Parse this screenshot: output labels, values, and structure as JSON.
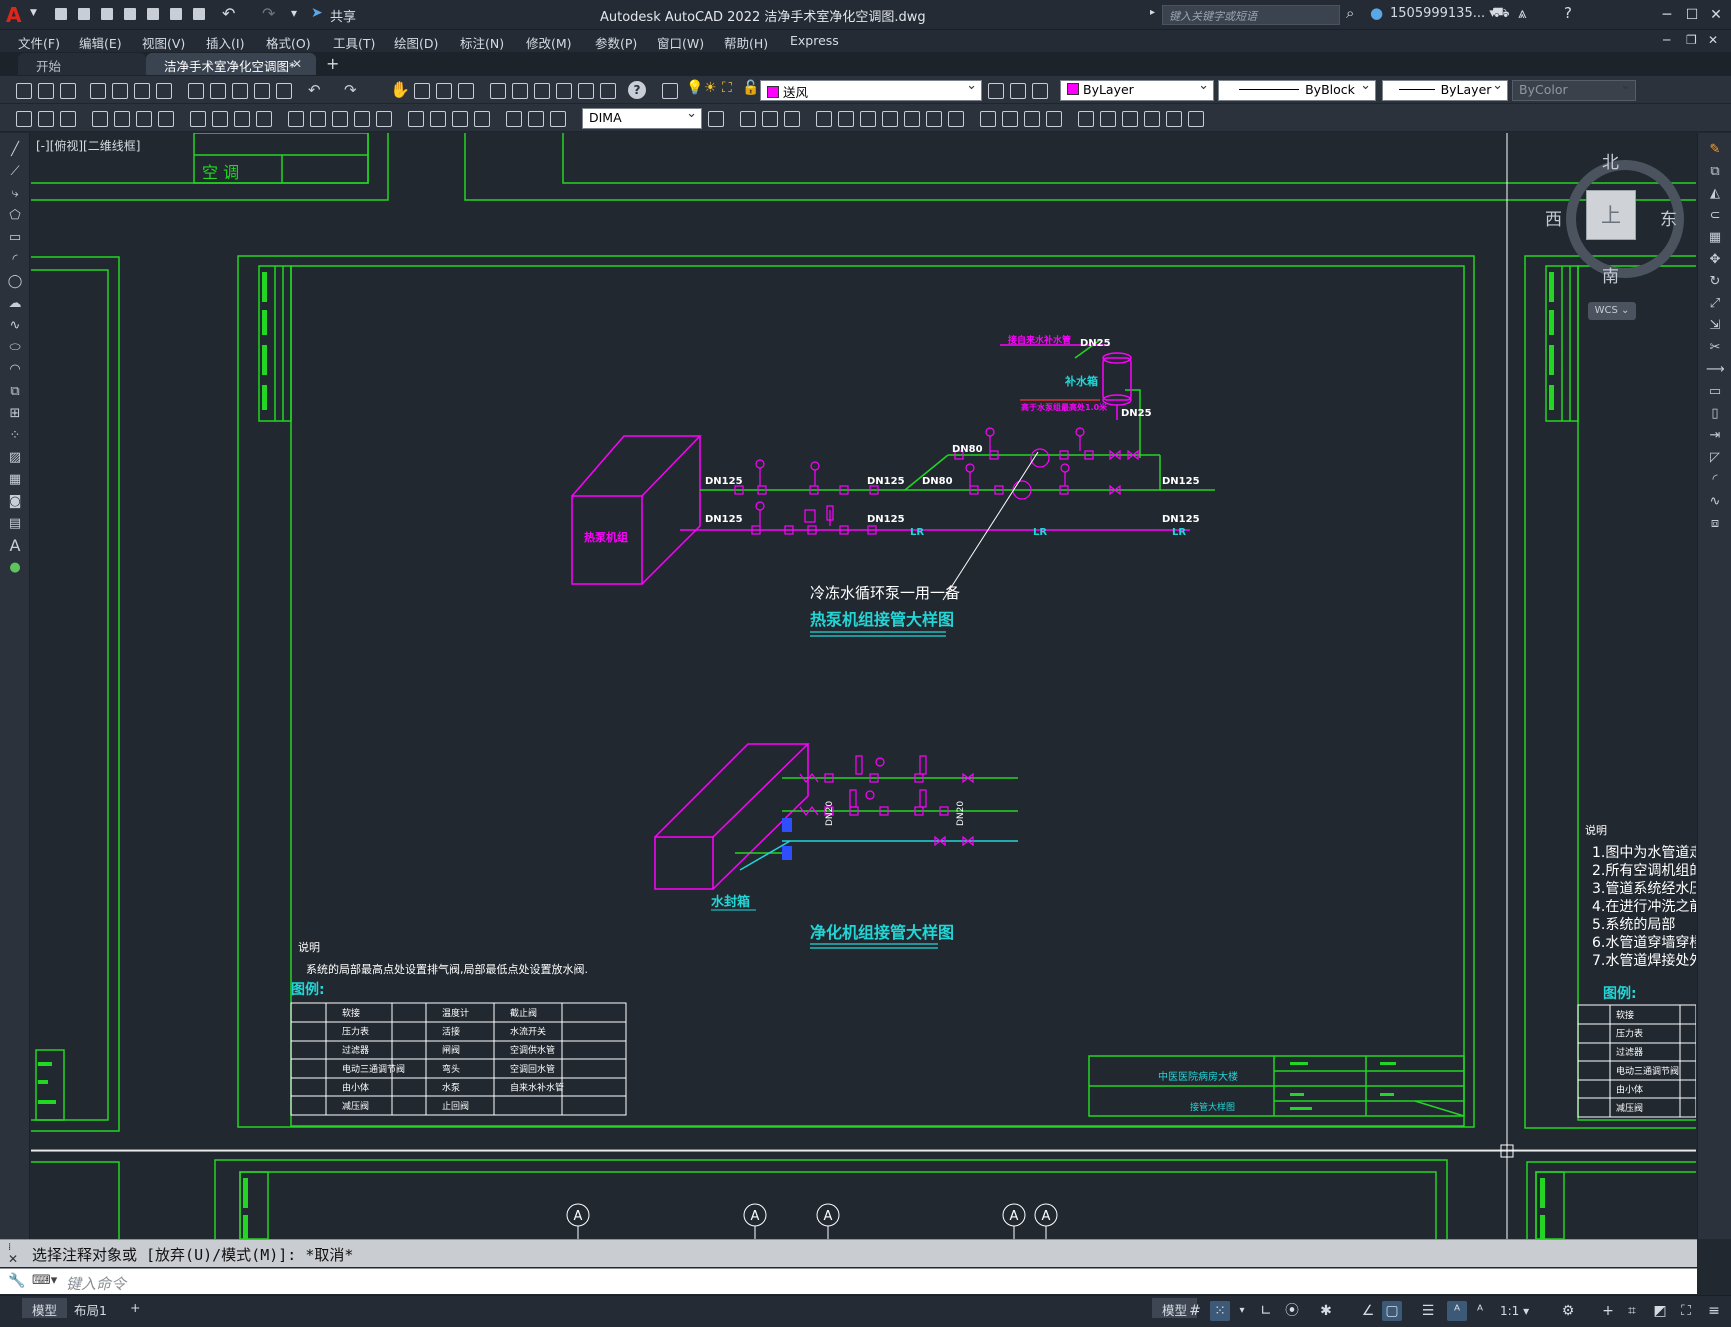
{
  "titlebar": {
    "app_title": "Autodesk AutoCAD 2022    洁净手术室净化空调图.dwg",
    "share_label": "共享",
    "search_placeholder": "键入关键字或短语",
    "user_name": "1505999135... ▾",
    "min": "─",
    "max": "☐",
    "close": "✕"
  },
  "menu": [
    "文件(F)",
    "编辑(E)",
    "视图(V)",
    "插入(I)",
    "格式(O)",
    "工具(T)",
    "绘图(D)",
    "标注(N)",
    "修改(M)",
    "参数(P)",
    "窗口(W)",
    "帮助(H)",
    "Express"
  ],
  "tabs": {
    "start": "开始",
    "active": "洁净手术室净化空调图*",
    "close": "✕",
    "add": "+"
  },
  "properties": {
    "layer": "送风",
    "color": "ByLayer",
    "linetype": "ByBlock",
    "lineweight": "ByLayer",
    "plotstyle": "ByColor",
    "dimstyle": "DIMA",
    "accent_color": "#ff00ff"
  },
  "viewport_label": "[-][俯视][二维线框]",
  "viewcube": {
    "north": "北",
    "south": "南",
    "east": "东",
    "west": "西",
    "top": "上",
    "wcs": "WCS ⌄"
  },
  "drawing": {
    "unit_label": "热泵机组",
    "tank_label": "补水箱",
    "tank_note": "接自来水补水管",
    "tank_note2": "高于水泵组最高处1.0米",
    "pump_note": "冷冻水循环泵一用一备",
    "title1": "热泵机组接管大样图",
    "title2": "净化机组接管大样图",
    "seal_label": "水封箱",
    "dn125": "DN125",
    "dn80": "DN80",
    "dn25": "DN25",
    "dn20": "DN20",
    "lr": "LR",
    "notes_head": "说明",
    "notes_text": "系统的局部最高点处设置排气阀,局部最低点处设置放水阀.",
    "legend_head": "图例:",
    "legend": [
      [
        "软接",
        "温度计",
        "截止阀"
      ],
      [
        "压力表",
        "活接",
        "水流开关"
      ],
      [
        "过滤器",
        "闸阀",
        "空调供水管"
      ],
      [
        "电动三通调节阀",
        "弯头",
        "空调回水管"
      ],
      [
        "由小体",
        "水泵",
        "自来水补水管"
      ],
      [
        "减压阀",
        "止回阀",
        ""
      ]
    ],
    "titleblock_project": "中医医院病房大楼",
    "titleblock_name": "接管大样图",
    "right_notes_head": "说明",
    "right_notes": [
      "1.图中为水管道走",
      "2.所有空调机组的",
      "3.管道系统经水压",
      "4.在进行冲洗之前",
      "5.系统的局部",
      "6.水管道穿墙穿楼",
      "7.水管道焊接处外"
    ],
    "right_legend_head": "图例:",
    "right_legend": [
      "软接",
      "压力表",
      "过滤器",
      "电动三通调节阀",
      "由小体",
      "减压阀"
    ],
    "top_title_cell": "空 调",
    "axis_marker": "A"
  },
  "command": {
    "history": "选择注释对象或 [放弃(U)/模式(M)]: *取消*",
    "placeholder": "键入命令"
  },
  "status": {
    "model": "模型",
    "layout1": "布局1",
    "add": "+",
    "scale": "1:1 ▾"
  }
}
